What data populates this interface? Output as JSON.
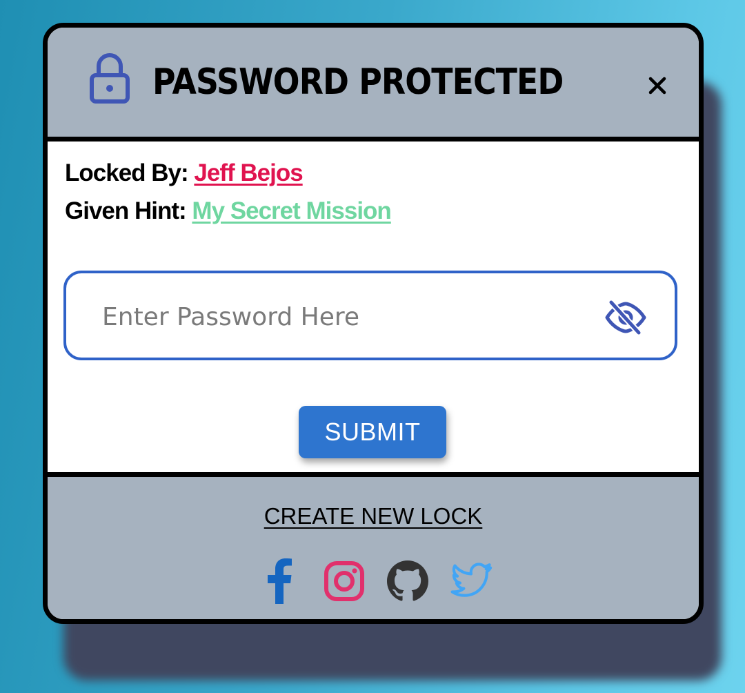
{
  "dialog": {
    "title": "PASSWORD PROTECTED",
    "close_icon": "close-icon",
    "lock_icon": "lock-icon"
  },
  "info": {
    "locked_by_label": "Locked By:",
    "locked_by_value": "Jeff Bejos",
    "hint_label": "Given Hint:",
    "hint_value": "My Secret Mission"
  },
  "password": {
    "placeholder": "Enter Password Here",
    "value": "",
    "toggle_icon": "eye-off-icon"
  },
  "submit_label": "SUBMIT",
  "footer": {
    "create_link": "CREATE NEW LOCK",
    "socials": [
      {
        "icon": "facebook-icon",
        "color": "#1565c0"
      },
      {
        "icon": "instagram-icon",
        "color": "#e1306c"
      },
      {
        "icon": "github-icon",
        "color": "#333333"
      },
      {
        "icon": "twitter-icon",
        "color": "#42a5f5"
      }
    ]
  },
  "colors": {
    "header_bg": "#a6b2bf",
    "accent": "#2e75cf",
    "field_border": "#2f62c8",
    "locked_by_link": "#e0134f",
    "hint_link": "#6fd6a0"
  }
}
